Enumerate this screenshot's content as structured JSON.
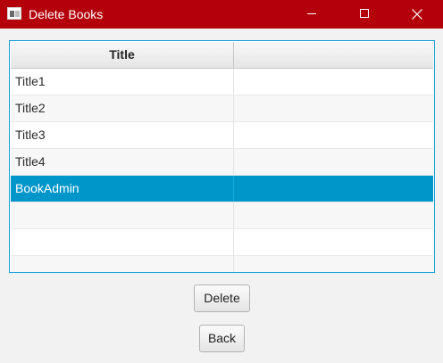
{
  "window": {
    "title": "Delete Books",
    "titlebar_color": "#b4000a",
    "icons": [
      "app-icon",
      "minimize-icon",
      "maximize-icon",
      "close-icon"
    ]
  },
  "table": {
    "columns": [
      "Title",
      ""
    ],
    "rows": [
      {
        "title": "Title1",
        "selected": false
      },
      {
        "title": "Title2",
        "selected": false
      },
      {
        "title": "Title3",
        "selected": false
      },
      {
        "title": "Title4",
        "selected": false
      },
      {
        "title": "BookAdmin",
        "selected": true
      },
      {
        "title": "",
        "selected": false
      },
      {
        "title": "",
        "selected": false
      },
      {
        "title": "",
        "selected": false
      }
    ],
    "selection_color": "#0096c9",
    "focus_border_color": "#1da1db"
  },
  "buttons": {
    "delete_label": "Delete",
    "back_label": "Back"
  }
}
